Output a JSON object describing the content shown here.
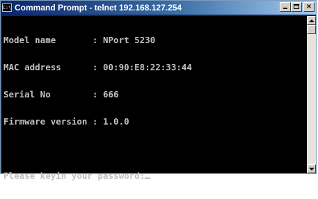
{
  "window": {
    "title": "Command Prompt - telnet 192.168.127.254",
    "icon": "console-icon",
    "icon_text": "C:\\",
    "buttons": {
      "minimize": "minimize",
      "maximize": "maximize",
      "close": "×"
    }
  },
  "console": {
    "lines": [
      "Model name       : NPort 5230",
      "MAC address      : 00:90:E8:22:33:44",
      "Serial No        : 666",
      "Firmware version : 1.0.0",
      "",
      "Please keyin your password:"
    ]
  },
  "colors": {
    "titlebar_start": "#0a246a",
    "titlebar_end": "#a6caf0",
    "console_bg": "#000000",
    "console_fg": "#c0c0c0"
  }
}
